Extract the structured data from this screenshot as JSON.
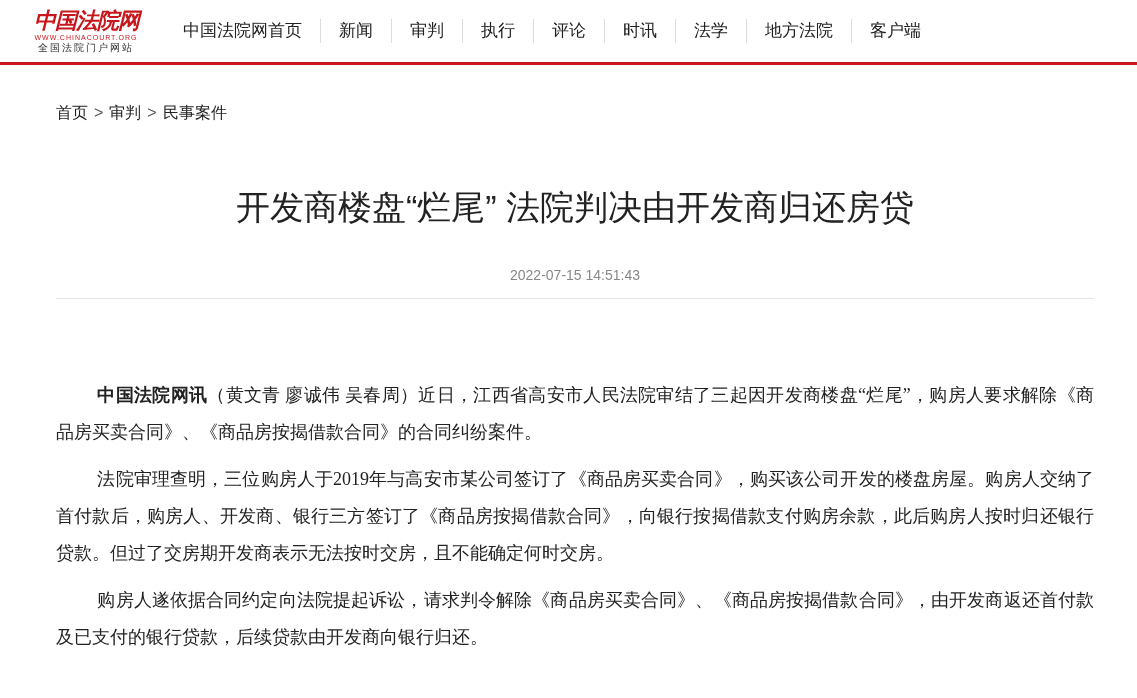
{
  "logo": {
    "name": "中国法院网",
    "url": "WWW.CHINACOURT.ORG",
    "tagline": "全国法院门户网站"
  },
  "nav": [
    {
      "label": "中国法院网首页"
    },
    {
      "label": "新闻"
    },
    {
      "label": "审判"
    },
    {
      "label": "执行"
    },
    {
      "label": "评论"
    },
    {
      "label": "时讯"
    },
    {
      "label": "法学"
    },
    {
      "label": "地方法院"
    },
    {
      "label": "客户端"
    }
  ],
  "breadcrumb": [
    {
      "kind": "link",
      "text": "首页"
    },
    {
      "kind": "separator",
      "text": ">"
    },
    {
      "kind": "link",
      "text": "审判"
    },
    {
      "kind": "separator",
      "text": ">"
    },
    {
      "kind": "link",
      "text": "民事案件"
    }
  ],
  "article": {
    "title": "开发商楼盘“烂尾” 法院判决由开发商归还房贷",
    "date": "2022-07-15 14:51:43",
    "paragraphs": [
      "**中国法院网讯**（黄文青  廖诚伟  吴春周）近日，江西省高安市人民法院审结了三起因开发商楼盘“烂尾”，购房人要求解除《商品房买卖合同》、《商品房按揭借款合同》的合同纠纷案件。",
      "法院审理查明，三位购房人于2019年与高安市某公司签订了《商品房买卖合同》，购买该公司开发的楼盘房屋。购房人交纳了首付款后，购房人、开发商、银行三方签订了《商品房按揭借款合同》，向银行按揭借款支付购房余款，此后购房人按时归还银行贷款。但过了交房期开发商表示无法按时交房，且不能确定何时交房。",
      "购房人遂依据合同约定向法院提起诉讼，请求判令解除《商品房买卖合同》、《商品房按揭借款合同》，由开发商返还首付款及已支付的银行贷款，后续贷款由开发商向银行归还。"
    ]
  }
}
